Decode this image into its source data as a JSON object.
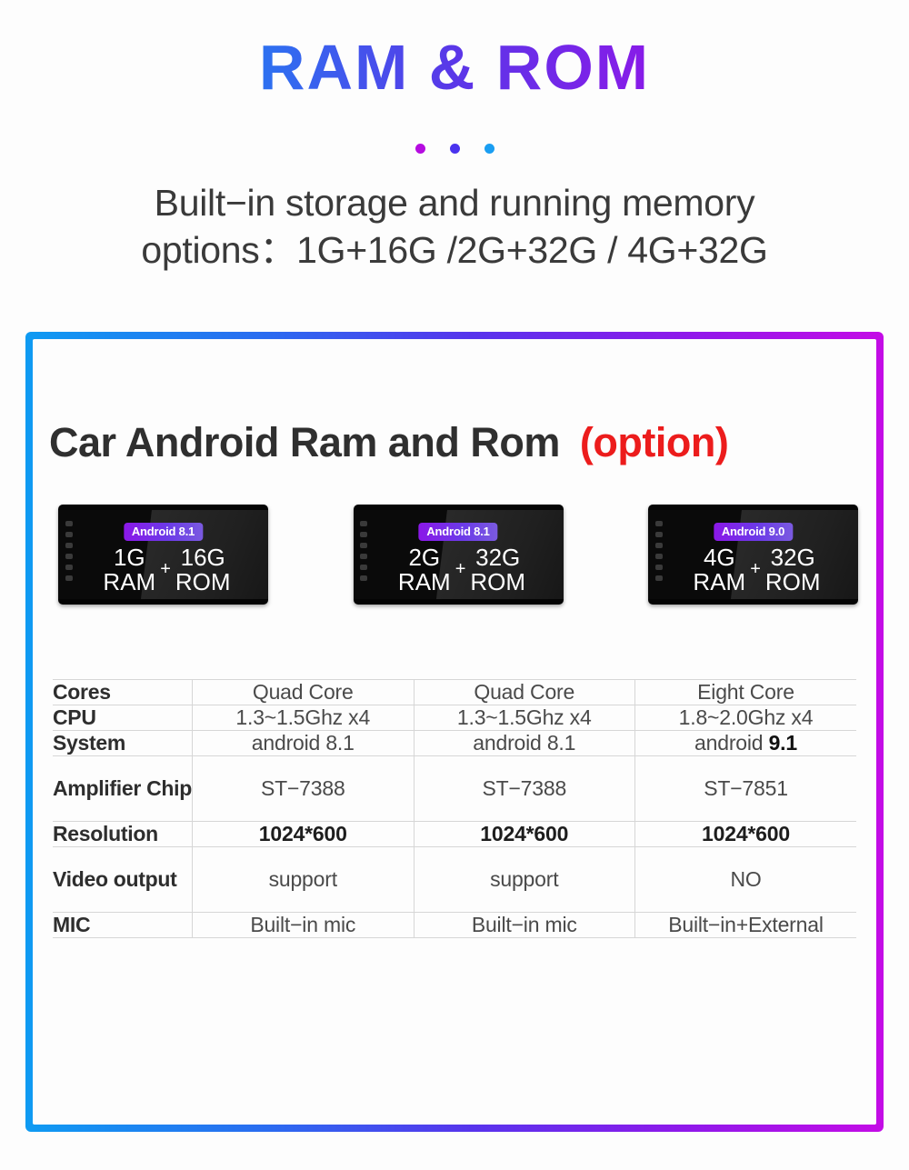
{
  "header": {
    "title": "RAM & ROM",
    "dots": [
      "dot-magenta",
      "dot-violet",
      "dot-blue"
    ],
    "subtitle_line1": "Built−in storage and running memory",
    "subtitle_line2": "options：1G+16G /2G+32G / 4G+32G"
  },
  "panel": {
    "heading_main": "Car Android Ram and Rom",
    "heading_option": "(option)",
    "devices": [
      {
        "badge": "Android 8.1",
        "ram_size": "1G",
        "ram_label": "RAM",
        "plus": "+",
        "rom_size": "16G",
        "rom_label": "ROM"
      },
      {
        "badge": "Android 8.1",
        "ram_size": "2G",
        "ram_label": "RAM",
        "plus": "+",
        "rom_size": "32G",
        "rom_label": "ROM"
      },
      {
        "badge": "Android 9.0",
        "ram_size": "4G",
        "ram_label": "RAM",
        "plus": "+",
        "rom_size": "32G",
        "rom_label": "ROM"
      }
    ],
    "table": {
      "rows": [
        {
          "label": "Cores",
          "values": [
            "Quad Core",
            "Quad Core",
            "Eight Core"
          ],
          "emphasis": false,
          "tall": false
        },
        {
          "label": "CPU",
          "values": [
            "1.3~1.5Ghz x4",
            "1.3~1.5Ghz x4",
            "1.8~2.0Ghz x4"
          ],
          "emphasis": false,
          "tall": false
        },
        {
          "label": "System",
          "values": [
            "android 8.1",
            "android 8.1",
            "android 9.1"
          ],
          "emphasis": false,
          "tall": false
        },
        {
          "label": "Amplifier Chip",
          "values": [
            "ST−7388",
            "ST−7388",
            "ST−7851"
          ],
          "emphasis": false,
          "tall": true
        },
        {
          "label": "Resolution",
          "values": [
            "1024*600",
            "1024*600",
            "1024*600"
          ],
          "emphasis": true,
          "tall": false
        },
        {
          "label": "Video output",
          "values": [
            "support",
            "support",
            "NO"
          ],
          "emphasis": false,
          "tall": true
        },
        {
          "label": "MIC",
          "values": [
            "Built−in mic",
            "Built−in mic",
            "Built−in+External"
          ],
          "emphasis": false,
          "tall": false
        }
      ]
    }
  },
  "colors": {
    "gradient_start": "#0f9bf2",
    "gradient_end": "#c40ce6",
    "option_red": "#ec1c1c",
    "badge_purple": "#8b18e8"
  }
}
